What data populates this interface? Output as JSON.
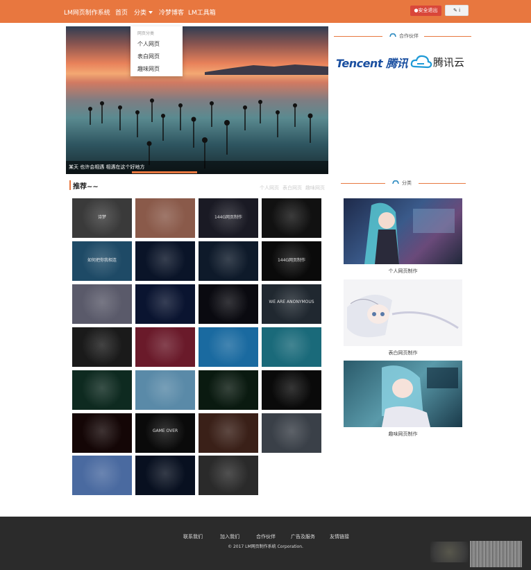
{
  "nav": {
    "brand": "LM网页制作系统",
    "items": [
      "首页",
      "分类",
      "冷梦博客",
      "LM工具箱"
    ],
    "logout": "安全退出",
    "edit": "i"
  },
  "dropdown": {
    "header": "网页分类",
    "options": [
      "个人网页",
      "表白网页",
      "趣味网页"
    ]
  },
  "hero": {
    "caption": "某天 也许会相遇 相遇在这个好地方"
  },
  "partners": {
    "title": "合作伙伴",
    "tencent": "Tencent 腾讯",
    "cloud": "腾讯云"
  },
  "recommend": {
    "title": "推荐~~",
    "tabs": [
      "个人网页",
      "表白网页",
      "趣味网页"
    ],
    "thumbs": [
      {
        "bg": "#3a3a3a",
        "txt": "诗梦"
      },
      {
        "bg": "#8a5a4a",
        "txt": ""
      },
      {
        "bg": "#1a1a24",
        "txt": "144G网页制作"
      },
      {
        "bg": "#111",
        "txt": ""
      },
      {
        "bg": "#1e4a66",
        "txt": "如何把你我相连"
      },
      {
        "bg": "#0a1428",
        "txt": ""
      },
      {
        "bg": "#0e1a2a",
        "txt": ""
      },
      {
        "bg": "#0a0a0a",
        "txt": "144G网页制作"
      },
      {
        "bg": "#5a5a6a",
        "txt": ""
      },
      {
        "bg": "#0a1430",
        "txt": ""
      },
      {
        "bg": "#0a0a10",
        "txt": ""
      },
      {
        "bg": "#202830",
        "txt": "WE ARE ANONYMOUS"
      },
      {
        "bg": "#1a1a1a",
        "txt": ""
      },
      {
        "bg": "#6a1a2a",
        "txt": ""
      },
      {
        "bg": "#1a6aa0",
        "txt": ""
      },
      {
        "bg": "#1a6a7a",
        "txt": ""
      },
      {
        "bg": "#0e2a20",
        "txt": ""
      },
      {
        "bg": "#5a8aa8",
        "txt": ""
      },
      {
        "bg": "#0a1a10",
        "txt": ""
      },
      {
        "bg": "#0a0a0a",
        "txt": ""
      },
      {
        "bg": "#140606",
        "txt": ""
      },
      {
        "bg": "#0a0a0a",
        "txt": "GAME OVER"
      },
      {
        "bg": "#3a2018",
        "txt": ""
      },
      {
        "bg": "#3a4048",
        "txt": ""
      },
      {
        "bg": "#4a6aa0",
        "txt": ""
      },
      {
        "bg": "#081020",
        "txt": ""
      },
      {
        "bg": "#2a2a2a",
        "txt": ""
      }
    ]
  },
  "category": {
    "title": "分类",
    "items": [
      "个人网页制作",
      "表白网页制作",
      "趣味网页制作"
    ]
  },
  "footer": {
    "links": [
      "联系我们",
      "加入我们",
      "合作伙伴",
      "广告及服务",
      "友情链接"
    ],
    "copyright": "© 2017 LM网页制作系统 Corporation."
  },
  "colors": {
    "accent": "#e8773f",
    "danger": "#d9473a",
    "footer": "#2b2b2b"
  }
}
